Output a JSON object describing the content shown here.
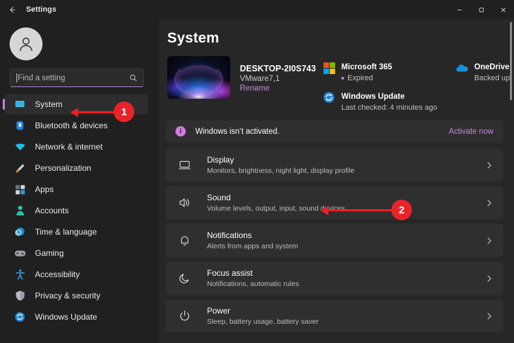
{
  "window": {
    "title": "Settings",
    "back_icon": "back-arrow-icon",
    "minimize_label": "–",
    "maximize_label": "□",
    "close_label": "✕"
  },
  "sidebar": {
    "avatar_icon": "user-avatar-icon",
    "search": {
      "placeholder": "Find a setting",
      "value": "",
      "icon": "search-icon"
    },
    "items": [
      {
        "label": "System",
        "icon": "monitor-icon",
        "selected": true
      },
      {
        "label": "Bluetooth & devices",
        "icon": "bluetooth-icon",
        "selected": false
      },
      {
        "label": "Network & internet",
        "icon": "wifi-icon",
        "selected": false
      },
      {
        "label": "Personalization",
        "icon": "paintbrush-icon",
        "selected": false
      },
      {
        "label": "Apps",
        "icon": "apps-grid-icon",
        "selected": false
      },
      {
        "label": "Accounts",
        "icon": "person-icon",
        "selected": false
      },
      {
        "label": "Time & language",
        "icon": "clock-globe-icon",
        "selected": false
      },
      {
        "label": "Gaming",
        "icon": "gamepad-icon",
        "selected": false
      },
      {
        "label": "Accessibility",
        "icon": "accessibility-icon",
        "selected": false
      },
      {
        "label": "Privacy & security",
        "icon": "shield-icon",
        "selected": false
      },
      {
        "label": "Windows Update",
        "icon": "update-sync-icon",
        "selected": false
      }
    ]
  },
  "main": {
    "page_title": "System",
    "device": {
      "thumbnail_icon": "windows-bloom-wallpaper",
      "name": "DESKTOP-2I0S743",
      "model": "VMware7,1",
      "rename_label": "Rename"
    },
    "status_cards": [
      {
        "title": "Microsoft 365",
        "subtitle": "Expired",
        "icon": "microsoft-logo-icon",
        "has_dot": true
      },
      {
        "title": "OneDrive",
        "subtitle": "Backed up",
        "icon": "onedrive-cloud-icon",
        "has_dot": false
      },
      {
        "title": "Windows Update",
        "subtitle": "Last checked: 4 minutes ago",
        "icon": "update-sync-icon",
        "has_dot": false
      }
    ],
    "activation_banner": {
      "icon": "info-icon",
      "icon_glyph": "i",
      "text": "Windows isn’t activated.",
      "link_label": "Activate now"
    },
    "rows": [
      {
        "title": "Display",
        "subtitle": "Monitors, brightness, night light, display profile",
        "icon": "display-monitor-icon",
        "chevron": "chevron-right-icon"
      },
      {
        "title": "Sound",
        "subtitle": "Volume levels, output, input, sound devices",
        "icon": "speaker-icon",
        "chevron": "chevron-right-icon"
      },
      {
        "title": "Notifications",
        "subtitle": "Alerts from apps and system",
        "icon": "bell-icon",
        "chevron": "chevron-right-icon"
      },
      {
        "title": "Focus assist",
        "subtitle": "Notifications, automatic rules",
        "icon": "moon-icon",
        "chevron": "chevron-right-icon"
      },
      {
        "title": "Power",
        "subtitle": "Sleep, battery usage, battery saver",
        "icon": "power-icon",
        "chevron": "chevron-right-icon"
      }
    ]
  },
  "annotations": [
    {
      "label": "1"
    },
    {
      "label": "2"
    }
  ],
  "colors": {
    "accent": "#c28ad8",
    "annotation_red": "#e8242a",
    "window_bg": "#202020",
    "main_bg": "#272727",
    "card_bg": "#2f2f2f"
  }
}
